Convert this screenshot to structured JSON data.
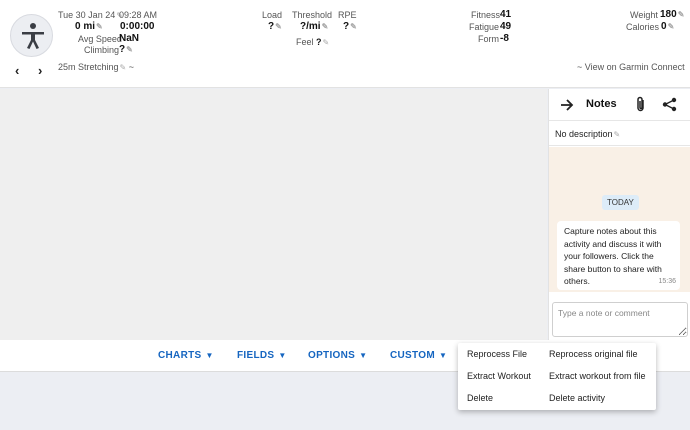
{
  "activity": {
    "date": "Tue 30 Jan 24",
    "time": "09:28 AM",
    "distance": "0 mi",
    "duration": "0:00:00",
    "avg_speed_label": "Avg Speed",
    "avg_speed_value": "NaN",
    "climbing_label": "Climbing",
    "climbing_value": "?",
    "title": "25m Stretching",
    "title_suffix": "~",
    "prev_icon": "chevron-left",
    "next_icon": "chevron-right"
  },
  "metrics": {
    "load_label": "Load",
    "load_value": "?",
    "threshold_label": "Threshold",
    "threshold_value": "?/mi",
    "rpe_label": "RPE",
    "rpe_value": "?",
    "feel_label": "Feel",
    "feel_value": "?"
  },
  "fitness": {
    "fitness_label": "Fitness",
    "fitness_value": "41",
    "fatigue_label": "Fatigue",
    "fatigue_value": "49",
    "form_label": "Form",
    "form_value": "-8"
  },
  "body": {
    "weight_label": "Weight",
    "weight_value": "180",
    "calories_label": "Calories",
    "calories_value": "0"
  },
  "garmin_link": "~ View on Garmin Connect",
  "notes": {
    "title": "Notes",
    "description": "No description",
    "today_label": "TODAY",
    "message": "Capture notes about this activity and discuss it with your followers. Click the share button to share with others.",
    "message_time": "15:36",
    "input_placeholder": "Type a note or comment"
  },
  "tabs": [
    {
      "label": "CHARTS"
    },
    {
      "label": "FIELDS"
    },
    {
      "label": "OPTIONS"
    },
    {
      "label": "CUSTOM"
    }
  ],
  "menu": [
    {
      "label": "Reprocess File",
      "description": "Reprocess original file"
    },
    {
      "label": "Extract Workout",
      "description": "Extract workout from file"
    },
    {
      "label": "Delete",
      "description": "Delete activity"
    }
  ],
  "colors": {
    "accent": "#1565c0",
    "chat_background": "#f9f0e6",
    "today_badge": "#ddecf8",
    "workspace": "#efefef"
  }
}
